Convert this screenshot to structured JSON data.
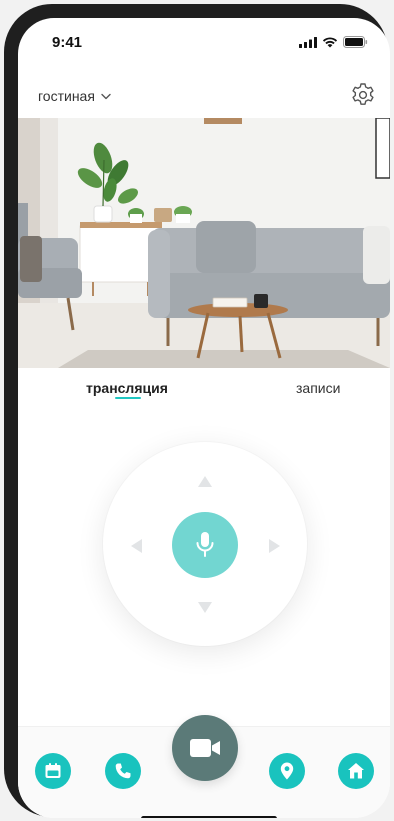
{
  "status_bar": {
    "time": "9:41"
  },
  "header": {
    "room_label": "гостиная",
    "room_dropdown_icon": "chevron-down-icon",
    "settings_icon": "gear-icon"
  },
  "camera_feed": {
    "scene": "living room camera view"
  },
  "tabs": [
    {
      "label": "трансляция",
      "active": true
    },
    {
      "label": "записи",
      "active": false
    }
  ],
  "ptz": {
    "arrows": [
      "up",
      "down",
      "left",
      "right"
    ],
    "center_icon": "microphone-icon"
  },
  "bottom_nav": {
    "items": [
      {
        "icon": "calendar-icon"
      },
      {
        "icon": "phone-icon"
      },
      {
        "icon": "video-camera-icon"
      },
      {
        "icon": "location-pin-icon"
      },
      {
        "icon": "home-icon"
      }
    ]
  },
  "colors": {
    "accent": "#19c3be",
    "mic_button": "#72d6d1",
    "video_button": "#5b7a78",
    "tab_underline": "#20c7c2"
  }
}
